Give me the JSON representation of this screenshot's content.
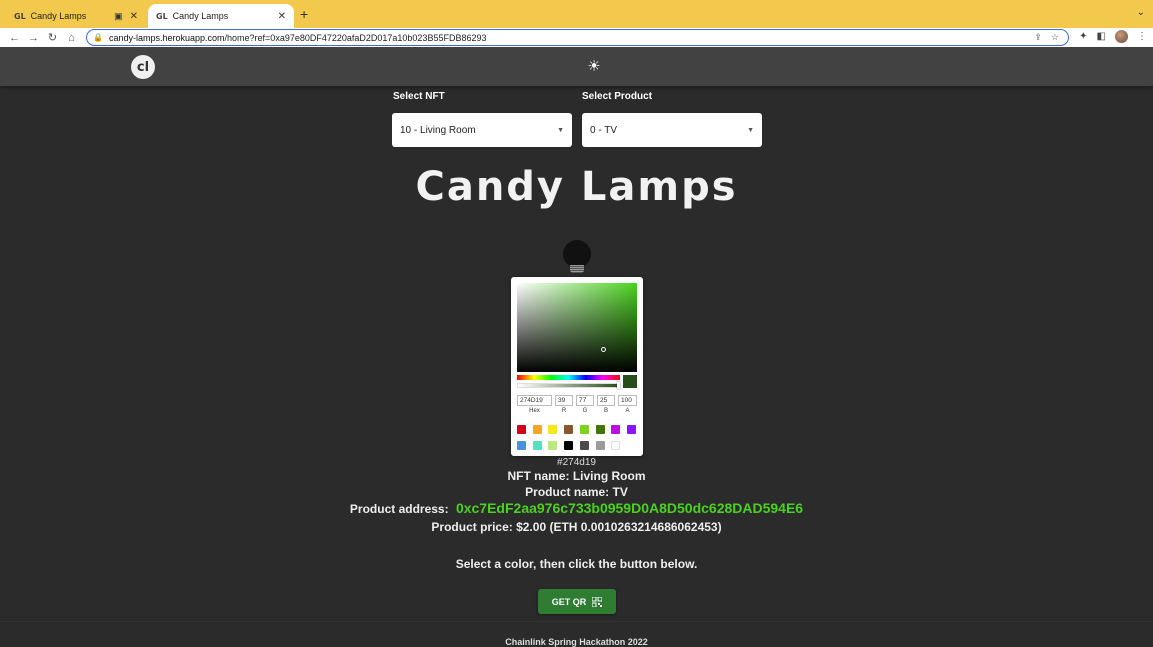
{
  "browser": {
    "tabs": [
      {
        "label": "Candy Lamps",
        "favicon": "GL",
        "active": false
      },
      {
        "label": "Candy Lamps",
        "favicon": "GL",
        "active": true
      }
    ],
    "new_tab_symbol": "+",
    "url_host": "candy-lamps.herokuapp.com",
    "url_rest": "/home?ref=0xa97e80DF47220afaD2D017a10b023B55FDB86293"
  },
  "header": {
    "logo_text": "cl",
    "theme_toggle_icon": "sun-icon"
  },
  "form": {
    "nft_label": "Select NFT",
    "nft_value": "10 - Living Room",
    "product_label": "Select Product",
    "product_value": "0 - TV"
  },
  "app_title": "Candy Lamps",
  "color_picker": {
    "hex": "274D19",
    "r": "39",
    "g": "77",
    "b": "25",
    "a": "100",
    "labels": {
      "hex": "Hex",
      "r": "R",
      "g": "G",
      "b": "B",
      "a": "A"
    },
    "current_color": "#274d19",
    "presets": [
      "#d0021b",
      "#f5a623",
      "#f8e71c",
      "#8b572a",
      "#7ed321",
      "#417505",
      "#bd10e0",
      "#9013fe",
      "#4a90e2",
      "#50e3c2",
      "#b8e986",
      "#000000",
      "#4a4a4a",
      "#9b9b9b",
      "#ffffff"
    ]
  },
  "hex_readout": "#274d19",
  "details": {
    "nft_name": "NFT name: Living Room",
    "product_name": "Product name: TV",
    "address_label": "Product address:",
    "address_value": "0xc7EdF2aa976c733b0959D0A8D50dc628DAD594E6",
    "price": "Product price: $2.00 (ETH 0.0010263214686062453)"
  },
  "instruction": "Select a color, then click the button below.",
  "qr_button_label": "GET QR",
  "footer_text": "Chainlink Spring Hackathon 2022",
  "colors": {
    "header_bg": "#424242",
    "page_bg": "#2b2b2b",
    "accent_green": "#4bd11f",
    "button_green": "#2e7d32",
    "tabstrip": "#f2c94c"
  }
}
